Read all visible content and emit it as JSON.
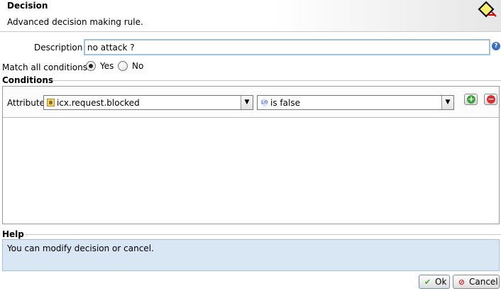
{
  "header": {
    "title": "Decision",
    "subtitle": "Advanced decision making rule.",
    "icon": "decision-diamond-icon"
  },
  "form": {
    "description_label": "Description",
    "description_value": "no attack ?",
    "match_all_label": "Match all conditions",
    "match_all_selected": "Yes",
    "yes_label": "Yes",
    "no_label": "No"
  },
  "conditions": {
    "title": "Conditions",
    "rows": [
      {
        "label": "Attribute",
        "attribute": "icx.request.blocked",
        "attribute_icon": "boolean-attribute-icon",
        "operator": "is false",
        "operator_icon": "boolean-operator-icon"
      }
    ]
  },
  "help": {
    "title": "Help",
    "text": "You can modify decision or cancel."
  },
  "buttons": {
    "ok": "Ok",
    "cancel": "Cancel"
  },
  "colors": {
    "help_background": "#d9e6f3",
    "input_focus_border": "#9fc3de",
    "add_green": "#3ea33e",
    "remove_red": "#d93030"
  }
}
